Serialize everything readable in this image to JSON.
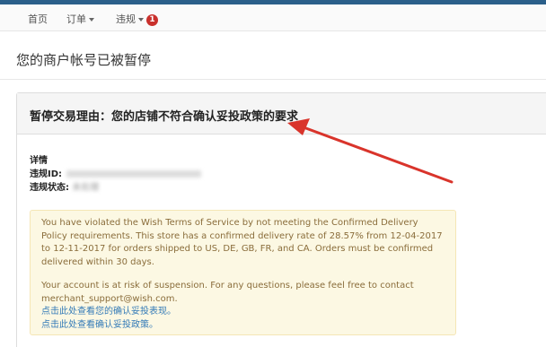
{
  "nav": {
    "home": "首页",
    "orders": "订单",
    "violations": "违规",
    "violations_badge": "1"
  },
  "page_title": "您的商户帐号已被暂停",
  "panel": {
    "heading": "暂停交易理由：您的店铺不符合确认妥投政策的要求",
    "details_title": "详情",
    "violation_id_label": "违规ID:",
    "violation_status_label": "违规状态:",
    "violation_status_value": "未处理"
  },
  "notice": {
    "paragraph1": "You have violated the Wish Terms of Service by not meeting the Confirmed Delivery Policy requirements. This store has a confirmed delivery rate of 28.57% from 12-04-2017 to 12-11-2017 for orders shipped to US, DE, GB, FR, and CA. Orders must be confirmed delivered within 30 days.",
    "paragraph2": "Your account is at risk of suspension. For any questions, please feel free to contact merchant_support@wish.com.",
    "link1": "点击此处查看您的确认妥投表现。",
    "link2": "点击此处查看确认妥投政策。"
  },
  "colors": {
    "arrow": "#d9342b",
    "badge": "#c9302c",
    "top_bar": "#2b5f8a",
    "notice_background": "#fcf8e3",
    "link": "#337ab7"
  }
}
